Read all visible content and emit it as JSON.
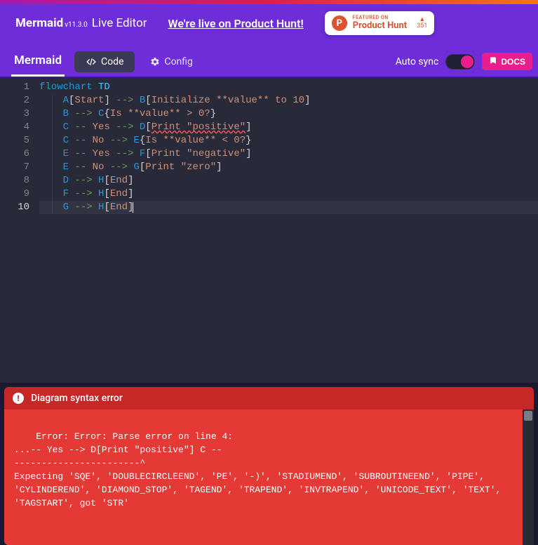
{
  "brand": {
    "name": "Mermaid",
    "version": "v11.3.0",
    "suffix": "Live Editor"
  },
  "ph_link": "We're live on Product Hunt!",
  "ph_badge": {
    "featured": "FEATURED ON",
    "label": "Product Hunt",
    "votes": "351"
  },
  "tabs": {
    "main": "Mermaid",
    "code": "Code",
    "config": "Config",
    "autosync": "Auto sync",
    "docs": "DOCS"
  },
  "code": {
    "lines": [
      [
        {
          "c": "tok-kw",
          "t": "flowchart"
        },
        {
          "c": "",
          "t": " "
        },
        {
          "c": "tok-dir",
          "t": "TD"
        }
      ],
      [
        {
          "c": "",
          "t": "    "
        },
        {
          "c": "tok-node",
          "t": "A"
        },
        {
          "c": "tok-br",
          "t": "["
        },
        {
          "c": "tok-txt",
          "t": "Start"
        },
        {
          "c": "tok-br",
          "t": "]"
        },
        {
          "c": "",
          "t": " "
        },
        {
          "c": "tok-arr",
          "t": "-->"
        },
        {
          "c": "",
          "t": " "
        },
        {
          "c": "tok-node",
          "t": "B"
        },
        {
          "c": "tok-br",
          "t": "["
        },
        {
          "c": "tok-txt",
          "t": "Initialize **value** to 10"
        },
        {
          "c": "tok-br",
          "t": "]"
        }
      ],
      [
        {
          "c": "",
          "t": "    "
        },
        {
          "c": "tok-node",
          "t": "B"
        },
        {
          "c": "",
          "t": " "
        },
        {
          "c": "tok-arr",
          "t": "-->"
        },
        {
          "c": "",
          "t": " "
        },
        {
          "c": "tok-node",
          "t": "C"
        },
        {
          "c": "tok-br",
          "t": "{"
        },
        {
          "c": "tok-txt",
          "t": "Is **value** > 0?"
        },
        {
          "c": "tok-br",
          "t": "}"
        }
      ],
      [
        {
          "c": "",
          "t": "    "
        },
        {
          "c": "tok-node",
          "t": "C"
        },
        {
          "c": "",
          "t": " "
        },
        {
          "c": "tok-arr",
          "t": "--"
        },
        {
          "c": "",
          "t": " "
        },
        {
          "c": "tok-txt",
          "t": "Yes"
        },
        {
          "c": "",
          "t": " "
        },
        {
          "c": "tok-arr",
          "t": "-->"
        },
        {
          "c": "",
          "t": " "
        },
        {
          "c": "tok-node",
          "t": "D"
        },
        {
          "c": "tok-br",
          "t": "["
        },
        {
          "c": "tok-txt wavy",
          "t": "Print \"positive\""
        },
        {
          "c": "tok-br",
          "t": "]"
        }
      ],
      [
        {
          "c": "",
          "t": "    "
        },
        {
          "c": "tok-node",
          "t": "C"
        },
        {
          "c": "",
          "t": " "
        },
        {
          "c": "tok-arr",
          "t": "--"
        },
        {
          "c": "",
          "t": " "
        },
        {
          "c": "tok-txt",
          "t": "No"
        },
        {
          "c": "",
          "t": " "
        },
        {
          "c": "tok-arr",
          "t": "-->"
        },
        {
          "c": "",
          "t": " "
        },
        {
          "c": "tok-node",
          "t": "E"
        },
        {
          "c": "tok-br",
          "t": "{"
        },
        {
          "c": "tok-txt",
          "t": "Is **value** < 0?"
        },
        {
          "c": "tok-br",
          "t": "}"
        }
      ],
      [
        {
          "c": "",
          "t": "    "
        },
        {
          "c": "tok-node",
          "t": "E"
        },
        {
          "c": "",
          "t": " "
        },
        {
          "c": "tok-arr",
          "t": "--"
        },
        {
          "c": "",
          "t": " "
        },
        {
          "c": "tok-txt",
          "t": "Yes"
        },
        {
          "c": "",
          "t": " "
        },
        {
          "c": "tok-arr",
          "t": "-->"
        },
        {
          "c": "",
          "t": " "
        },
        {
          "c": "tok-node",
          "t": "F"
        },
        {
          "c": "tok-br",
          "t": "["
        },
        {
          "c": "tok-txt",
          "t": "Print \"negative\""
        },
        {
          "c": "tok-br",
          "t": "]"
        }
      ],
      [
        {
          "c": "",
          "t": "    "
        },
        {
          "c": "tok-node",
          "t": "E"
        },
        {
          "c": "",
          "t": " "
        },
        {
          "c": "tok-arr",
          "t": "--"
        },
        {
          "c": "",
          "t": " "
        },
        {
          "c": "tok-txt",
          "t": "No"
        },
        {
          "c": "",
          "t": " "
        },
        {
          "c": "tok-arr",
          "t": "-->"
        },
        {
          "c": "",
          "t": " "
        },
        {
          "c": "tok-node",
          "t": "G"
        },
        {
          "c": "tok-br",
          "t": "["
        },
        {
          "c": "tok-txt",
          "t": "Print \"zero\""
        },
        {
          "c": "tok-br",
          "t": "]"
        }
      ],
      [
        {
          "c": "",
          "t": "    "
        },
        {
          "c": "tok-node",
          "t": "D"
        },
        {
          "c": "",
          "t": " "
        },
        {
          "c": "tok-arr",
          "t": "-->"
        },
        {
          "c": "",
          "t": " "
        },
        {
          "c": "tok-node",
          "t": "H"
        },
        {
          "c": "tok-br",
          "t": "["
        },
        {
          "c": "tok-txt",
          "t": "End"
        },
        {
          "c": "tok-br",
          "t": "]"
        }
      ],
      [
        {
          "c": "",
          "t": "    "
        },
        {
          "c": "tok-node",
          "t": "F"
        },
        {
          "c": "",
          "t": " "
        },
        {
          "c": "tok-arr",
          "t": "-->"
        },
        {
          "c": "",
          "t": " "
        },
        {
          "c": "tok-node",
          "t": "H"
        },
        {
          "c": "tok-br",
          "t": "["
        },
        {
          "c": "tok-txt",
          "t": "End"
        },
        {
          "c": "tok-br",
          "t": "]"
        }
      ],
      [
        {
          "c": "",
          "t": "    "
        },
        {
          "c": "tok-node",
          "t": "G"
        },
        {
          "c": "",
          "t": " "
        },
        {
          "c": "tok-arr",
          "t": "-->"
        },
        {
          "c": "",
          "t": " "
        },
        {
          "c": "tok-node",
          "t": "H"
        },
        {
          "c": "tok-br",
          "t": "["
        },
        {
          "c": "tok-txt",
          "t": "End"
        },
        {
          "c": "tok-br",
          "t": "]"
        }
      ]
    ],
    "active_line": 10
  },
  "error": {
    "title": "Diagram syntax error",
    "body": "Error: Error: Parse error on line 4:\n...-- Yes --> D[Print \"positive\"] C --\n-----------------------^\nExpecting 'SQE', 'DOUBLECIRCLEEND', 'PE', '-)', 'STADIUMEND', 'SUBROUTINEEND', 'PIPE', 'CYLINDEREND', 'DIAMOND_STOP', 'TAGEND', 'TRAPEND', 'INVTRAPEND', 'UNICODE_TEXT', 'TEXT', 'TAGSTART', got 'STR'"
  }
}
